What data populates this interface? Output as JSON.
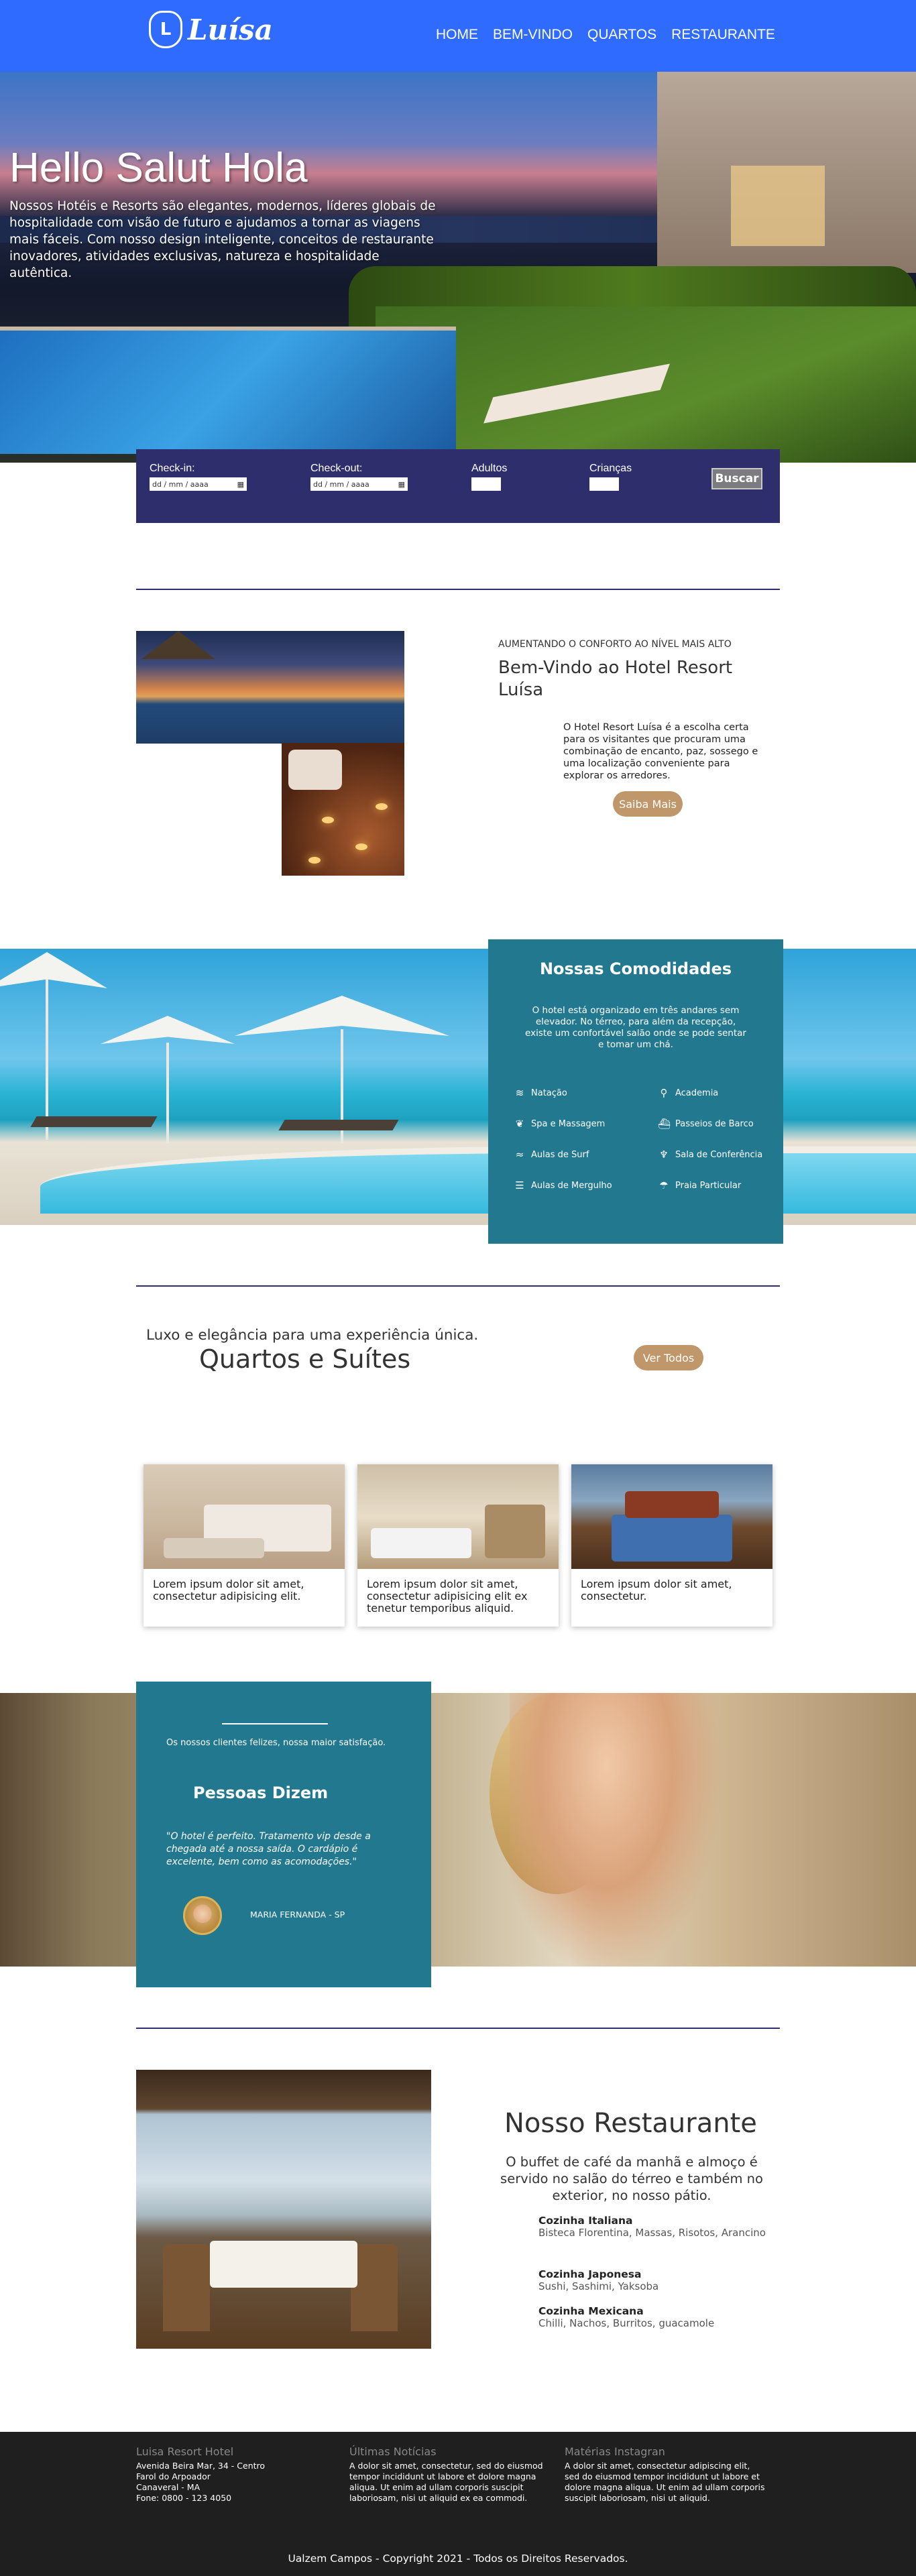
{
  "brand": {
    "logo_letter": "L",
    "name": "Luísa"
  },
  "nav": {
    "items": [
      "HOME",
      "BEM-VINDO",
      "QUARTOS",
      "RESTAURANTE"
    ]
  },
  "hero": {
    "title": "Hello Salut Hola",
    "text": "Nossos Hotéis e Resorts são elegantes, modernos, líderes globais de hospitalidade com visão de futuro e ajudamos a tornar as viagens mais fáceis. Com nosso design inteligente, conceitos de restaurante inovadores, atividades exclusivas, natureza e hospitalidade autêntica."
  },
  "booking": {
    "checkin_label": "Check-in:",
    "checkout_label": "Check-out:",
    "adults_label": "Adultos",
    "children_label": "Crianças",
    "date_placeholder": "dd / mm / aaaa",
    "search_button": "Buscar"
  },
  "welcome": {
    "kicker": "AUMENTANDO O CONFORTO AO NÍVEL MAIS ALTO",
    "title": "Bem-Vindo ao Hotel Resort Luísa",
    "text": "O Hotel Resort Luísa é a escolha certa para os visitantes que procuram uma combinação de encanto, paz, sossego e uma localização conveniente para explorar os arredores.",
    "button": "Saiba Mais"
  },
  "amenities": {
    "title": "Nossas Comodidades",
    "text": "O hotel está organizado em três andares sem elevador. No térreo, para além da recepção, existe um confortável salão onde se pode sentar e tomar um chá.",
    "items": [
      {
        "icon": "swimmer-icon",
        "glyph": "≋",
        "label": "Natação"
      },
      {
        "icon": "dumbbell-icon",
        "glyph": "⚲",
        "label": "Academia"
      },
      {
        "icon": "spa-icon",
        "glyph": "❦",
        "label": "Spa e Massagem"
      },
      {
        "icon": "bus-icon",
        "glyph": "⛴",
        "label": "Passeios de Barco"
      },
      {
        "icon": "surf-icon",
        "glyph": "≈",
        "label": "Aulas de Surf"
      },
      {
        "icon": "microphone-icon",
        "glyph": "♆",
        "label": "Sala de Conferência"
      },
      {
        "icon": "diving-icon",
        "glyph": "☰",
        "label": "Aulas de Mergulho"
      },
      {
        "icon": "umbrella-beach-icon",
        "glyph": "☂",
        "label": "Praia Particular"
      }
    ]
  },
  "rooms": {
    "subtitle": "Luxo e elegância para uma experiência única.",
    "title": "Quartos e Suítes",
    "button": "Ver Todos",
    "cards": [
      {
        "text": "Lorem ipsum dolor sit amet, consectetur adipisicing elit."
      },
      {
        "text": "Lorem ipsum dolor sit amet, consectetur adipisicing elit ex tenetur temporibus aliquid."
      },
      {
        "text": "Lorem ipsum dolor sit amet, consectetur."
      }
    ]
  },
  "testimonial": {
    "kicker": "Os nossos clientes felizes, nossa maior satisfação.",
    "title": "Pessoas Dizem",
    "quote": "\"O hotel é perfeito. Tratamento vip desde a chegada até a nossa saída. O cardápio é excelente, bem como as acomodações.\"",
    "name": "MARIA FERNANDA - SP"
  },
  "restaurant": {
    "title": "Nosso Restaurante",
    "lead": "O buffet de café da manhã e almoço é servido no salão do térreo e também no exterior, no nosso pátio.",
    "cuisines": [
      {
        "name": "Cozinha Italiana",
        "dishes": "Bisteca Florentina, Massas, Risotos, Arancino"
      },
      {
        "name": "Cozinha Japonesa",
        "dishes": "Sushi, Sashimi, Yaksoba"
      },
      {
        "name": "Cozinha Mexicana",
        "dishes": "Chilli, Nachos, Burritos, guacamole"
      }
    ]
  },
  "footer": {
    "col1_title": "Luisa Resort Hotel",
    "col1_lines": [
      "Avenida Beira Mar, 34 - Centro",
      "Farol do Arpoador",
      "Canaveral - MA",
      "Fone: 0800 - 123 4050"
    ],
    "col2_title": "Últimas Notícias",
    "col2_text": "A dolor sit amet, consectetur, sed do eiusmod tempor incididunt ut labore et dolore magna aliqua. Ut enim ad ullam corporis suscipit laboriosam, nisi ut aliquid ex ea commodi.",
    "col3_title": "Matérias Instagran",
    "col3_text": "A dolor sit amet, consectetur adipiscing elit, sed do eiusmod tempor incididunt ut labore et dolore magna aliqua. Ut enim ad ullam corporis suscipit laboriosam, nisi ut aliquid.",
    "copyright": "Ualzem Campos - Copyright 2021 - Todos os Direitos Reservados."
  }
}
